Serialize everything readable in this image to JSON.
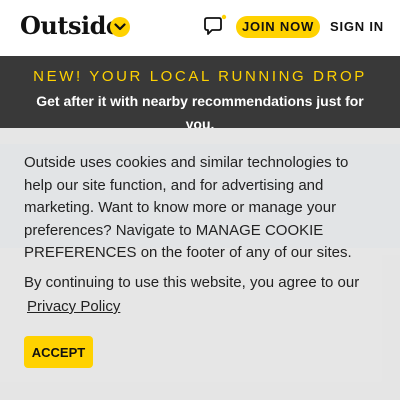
{
  "header": {
    "logo_text": "Outside",
    "join_label": "JOIN NOW",
    "signin_label": "SIGN IN"
  },
  "promo": {
    "title": "NEW! YOUR LOCAL RUNNING DROP",
    "subtitle": "Get after it with nearby recommendations just for you."
  },
  "cookie": {
    "notice": "Outside uses cookies and similar technologies to help our site function, and for advertising and marketing. Want to know more or manage your preferences? Navigate to MANAGE COOKIE PREFERENCES on the footer of any of our sites.",
    "consent": "By continuing to use this website, you agree to our",
    "privacy_link": "Privacy Policy",
    "accept_label": "ACCEPT"
  },
  "icons": {
    "logo_chevron": "chevron-down-icon",
    "chat": "chat-bubble-icon"
  },
  "colors": {
    "accent": "#ffd200",
    "banner": "#393939",
    "overlay": "#e0e0e0"
  }
}
